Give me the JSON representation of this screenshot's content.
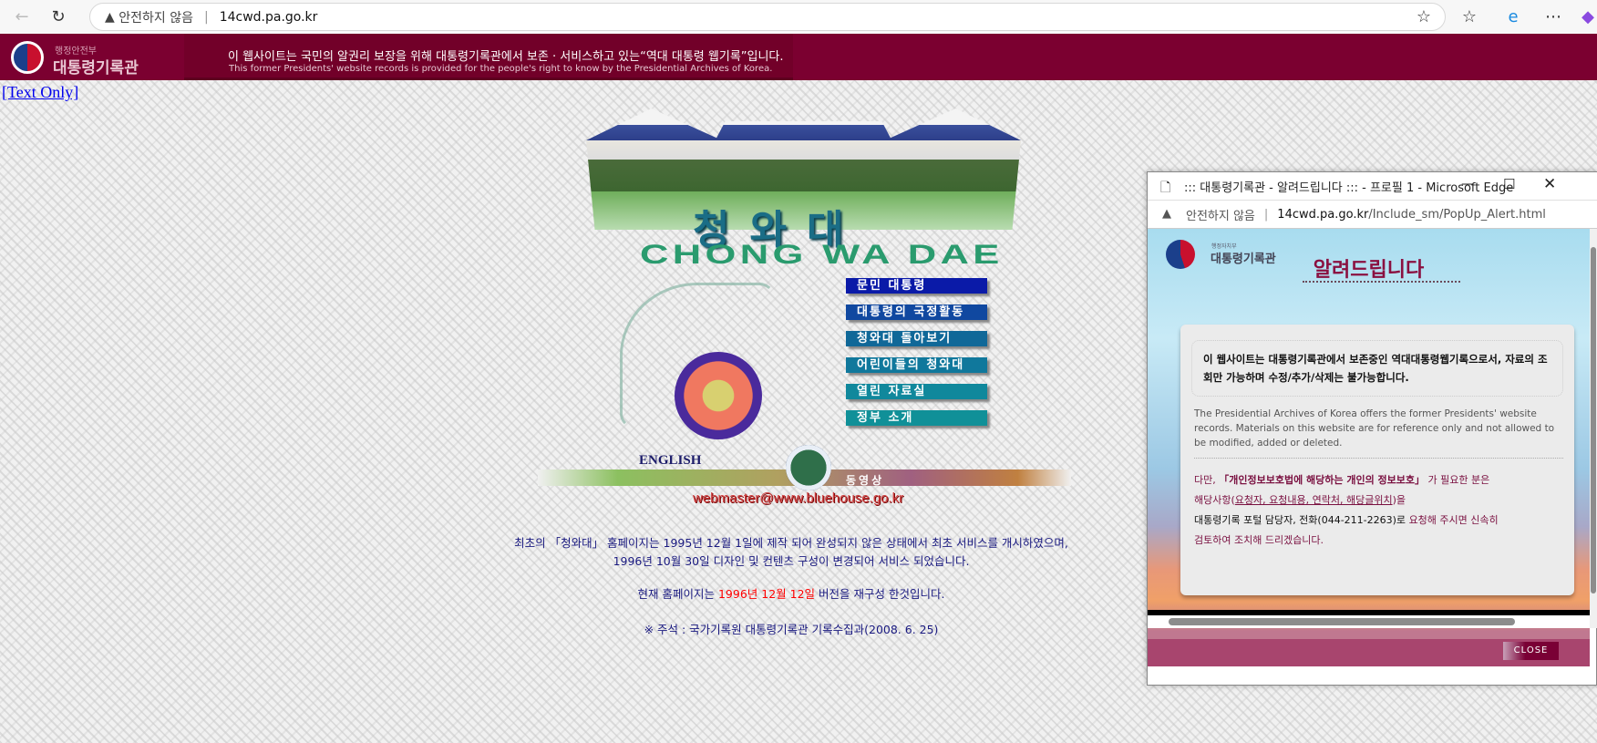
{
  "browser": {
    "not_secure": "안전하지 않음",
    "url": "14cwd.pa.go.kr"
  },
  "banner": {
    "logo_small": "행정안전부",
    "logo_big": "대통령기록관",
    "notice_ko": "이 웹사이트는 국민의 알권리 보장을 위해 대통령기록관에서 보존 · 서비스하고 있는“역대 대통령 웹기록”입니다.",
    "notice_en": "This former Presidents' website records is provided for the people's right to know by the Presidential Archives of Korea."
  },
  "page": {
    "text_only": "[Text Only]",
    "title_ko": "청와대",
    "title_en": "CHONG WA DAE",
    "menu": [
      {
        "label": "문민 대통령",
        "color": "#0a1aa8"
      },
      {
        "label": "대통령의 국정활동",
        "color": "#1048a0"
      },
      {
        "label": "청와대 돌아보기",
        "color": "#106898"
      },
      {
        "label": "어린이들의 청와대",
        "color": "#10789c"
      },
      {
        "label": "열린 자료실",
        "color": "#10889c"
      },
      {
        "label": "정부 소개",
        "color": "#109098"
      }
    ],
    "english": "ENGLISH",
    "video": "동영상",
    "email": "webmaster@www.bluehouse.go.kr",
    "note1": "최초의 「청와대」 홈페이지는 1995년 12월 1일에 제작 되어 완성되지 않은 상태에서 최초 서비스를 개시하였으며,",
    "note2": "1996년 10월 30일 디자인 및 컨텐츠 구성이 변경되어 서비스 되었습니다.",
    "note3_pre": "현재 홈페이지는 ",
    "note3_red": "1996년 12월 12일",
    "note3_post": " 버전을 재구성 한것입니다.",
    "note4": "※ 주석 : 국가기록원 대통령기록관 기록수집과(2008. 6. 25)"
  },
  "popup": {
    "window_title": "::: 대통령기록관 - 알려드립니다 ::: - 프로필 1 - Microsoft Edge",
    "not_secure": "안전하지 않음",
    "url_host": "14cwd.pa.go.kr",
    "url_path": "/Include_sm/PopUp_Alert.html",
    "logo_small": "행정자치부",
    "logo_big": "대통령기록관",
    "heading": "알려드립니다",
    "box_text": "이 웹사이트는 대통령기록관에서 보존중인 역대대통령웹기록으로서, 자료의 조회만 가능하며 수정/추가/삭제는 불가능합니다.",
    "english": "The Presidential Archives of Korea offers the former Presidents' website records. Materials on this website are for reference only and not allowed to be modified, added or deleted.",
    "p1_pre": "다만, ",
    "p1_bold": "「개인정보보호법에 해당하는 개인의 정보보호」",
    "p1_post": "가 필요한 분은",
    "p2_pre": "해당사항(",
    "p2_link": "요청자, 요청내용, 연락처, 해당글위치",
    "p2_post": ")을",
    "p3_black": "대통령기록 포털 담당자, 전화(044-211-2263)로 ",
    "p3_red": "요청해 주시면 신속히",
    "p4": "검토하여 조치해 드리겠습니다.",
    "close": "CLOSE"
  }
}
